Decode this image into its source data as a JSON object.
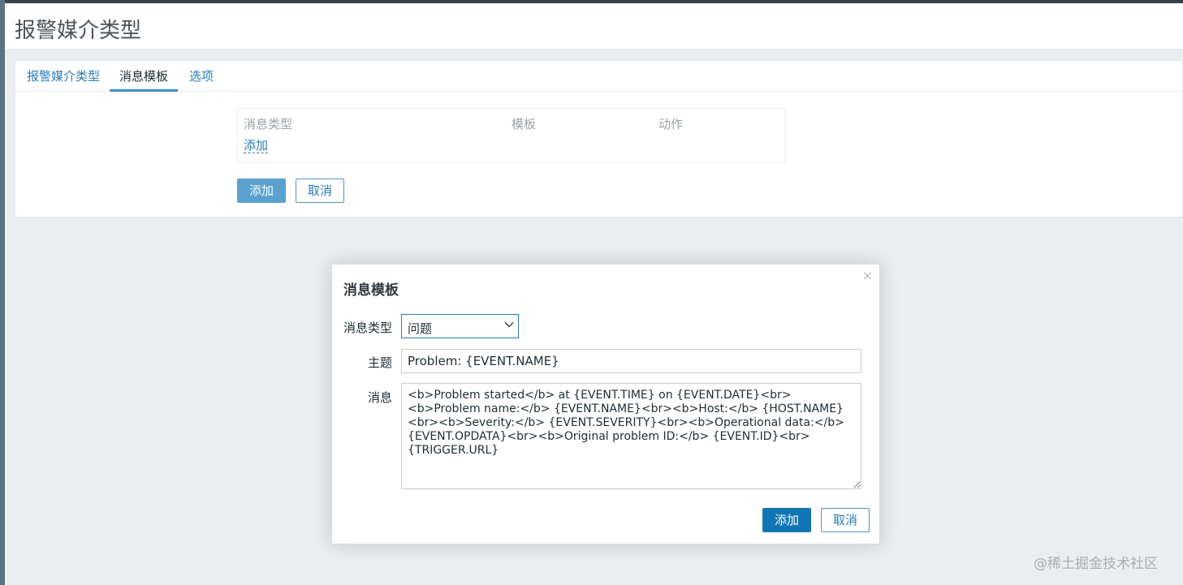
{
  "page": {
    "title": "报警媒介类型"
  },
  "tabs": [
    {
      "label": "报警媒介类型",
      "active": false
    },
    {
      "label": "消息模板",
      "active": true
    },
    {
      "label": "选项",
      "active": false
    }
  ],
  "template_table": {
    "columns": [
      "消息类型",
      "模板",
      "动作"
    ],
    "add_link": "添加"
  },
  "form_buttons": {
    "add": "添加",
    "cancel": "取消"
  },
  "modal": {
    "title": "消息模板",
    "close": "×",
    "fields": {
      "message_type_label": "消息类型",
      "message_type_value": "问题",
      "subject_label": "主题",
      "subject_value": "Problem: {EVENT.NAME}",
      "message_label": "消息",
      "message_value": "<b>Problem started</b> at {EVENT.TIME} on {EVENT.DATE}<br><b>Problem name:</b> {EVENT.NAME}<br><b>Host:</b> {HOST.NAME}<br><b>Severity:</b> {EVENT.SEVERITY}<br><b>Operational data:</b> {EVENT.OPDATA}<br><b>Original problem ID:</b> {EVENT.ID}<br>{TRIGGER.URL}"
    },
    "buttons": {
      "add": "添加",
      "cancel": "取消"
    }
  },
  "watermark": "@稀土掘金技术社区",
  "colors": {
    "link": "#2a7bb5",
    "primary": "#0f75b5",
    "primary_dim": "#5aa1cf",
    "background": "#ebeef0"
  }
}
